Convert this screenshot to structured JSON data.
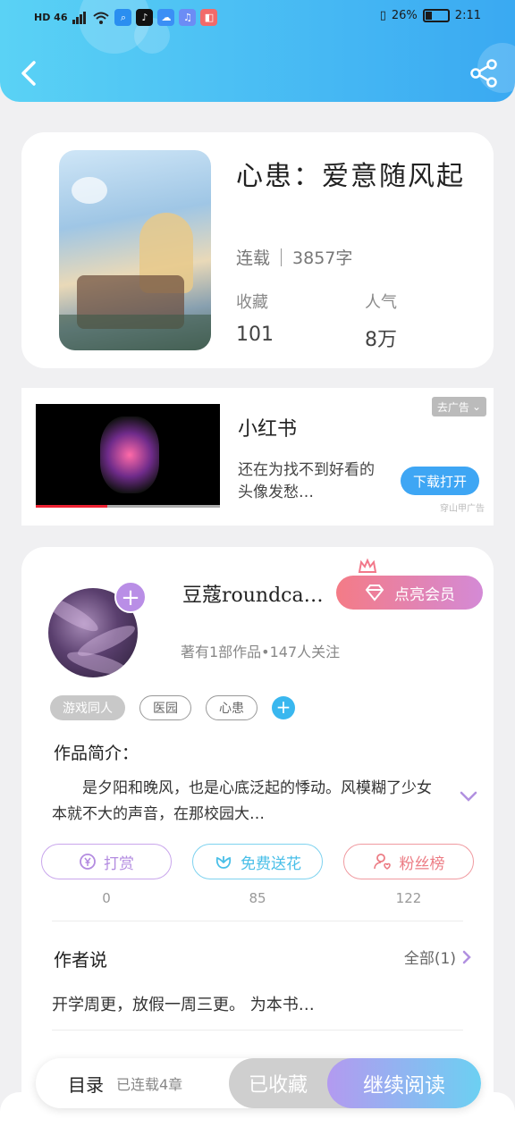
{
  "statusbar": {
    "network": "HD 46",
    "battery": "26%",
    "time": "2:11"
  },
  "colors": {
    "header_start": "#5ad2f5",
    "header_end": "#3aa9f2",
    "accent_purple": "#b98ee6",
    "accent_blue": "#39b7ef"
  },
  "book": {
    "title": "心患：爱意随风起",
    "status": "连载",
    "words": "3857字",
    "collect_label": "收藏",
    "collect_value": "101",
    "popularity_label": "人气",
    "popularity_value": "8万"
  },
  "ad": {
    "title": "小红书",
    "desc": "还在为找不到好看的头像发愁…",
    "close_label": "去广告",
    "button_label": "下载打开",
    "source": "穿山甲广告"
  },
  "author": {
    "name": "豆蔻roundca…",
    "vip_label": "点亮会员",
    "sub": "著有1部作品•147人关注",
    "tags": [
      "游戏同人",
      "医园",
      "心患"
    ]
  },
  "intro": {
    "heading": "作品简介：",
    "text": "是夕阳和晚风，也是心底泛起的悸动。风模糊了少女本就不大的声音，在那校园大…"
  },
  "actions": [
    {
      "label": "打赏",
      "count": "0"
    },
    {
      "label": "免费送花",
      "count": "85"
    },
    {
      "label": "粉丝榜",
      "count": "122"
    }
  ],
  "author_says": {
    "heading": "作者说",
    "link": "全部(1)",
    "text": "开学周更，放假一周三更。 为本书…"
  },
  "bottom": {
    "toc_label": "目录",
    "toc_info": "已连载4章",
    "collected_label": "已收藏",
    "continue_label": "继续阅读"
  }
}
